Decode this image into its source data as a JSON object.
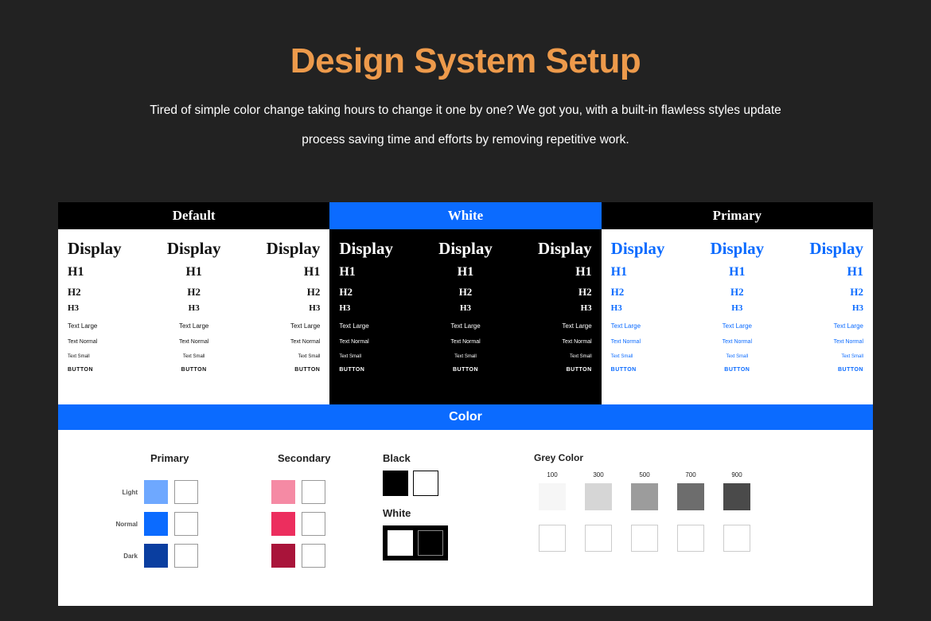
{
  "title": "Design System Setup",
  "subtitle": "Tired of simple color change taking hours to change it one by one? We got you, with a built-in flawless styles update process saving time and efforts by removing repetitive work.",
  "type_headers": {
    "default": "Default",
    "white": "White",
    "primary": "Primary"
  },
  "type_labels": {
    "display": "Display",
    "h1": "H1",
    "h2": "H2",
    "h3": "H3",
    "text_large": "Text Large",
    "text_normal": "Text Normal",
    "text_small": "Text Small",
    "button": "BUTTON"
  },
  "color_bar": "Color",
  "colors": {
    "primary_label": "Primary",
    "secondary_label": "Secondary",
    "black_label": "Black",
    "white_label": "White",
    "grey_label": "Grey Color",
    "row_labels": {
      "light": "Light",
      "normal": "Normal",
      "dark": "Dark"
    },
    "primary": {
      "light": "#6ea8ff",
      "normal": "#0b6bff",
      "dark": "#0a3ea0"
    },
    "secondary": {
      "light": "#f58aa4",
      "normal": "#ec2e5e",
      "dark": "#a9143a"
    },
    "grey_scale": {
      "labels": [
        "100",
        "300",
        "500",
        "700",
        "900"
      ],
      "values": [
        "#f6f6f6",
        "#d6d6d6",
        "#9c9c9c",
        "#6d6d6d",
        "#4a4a4a"
      ]
    }
  }
}
